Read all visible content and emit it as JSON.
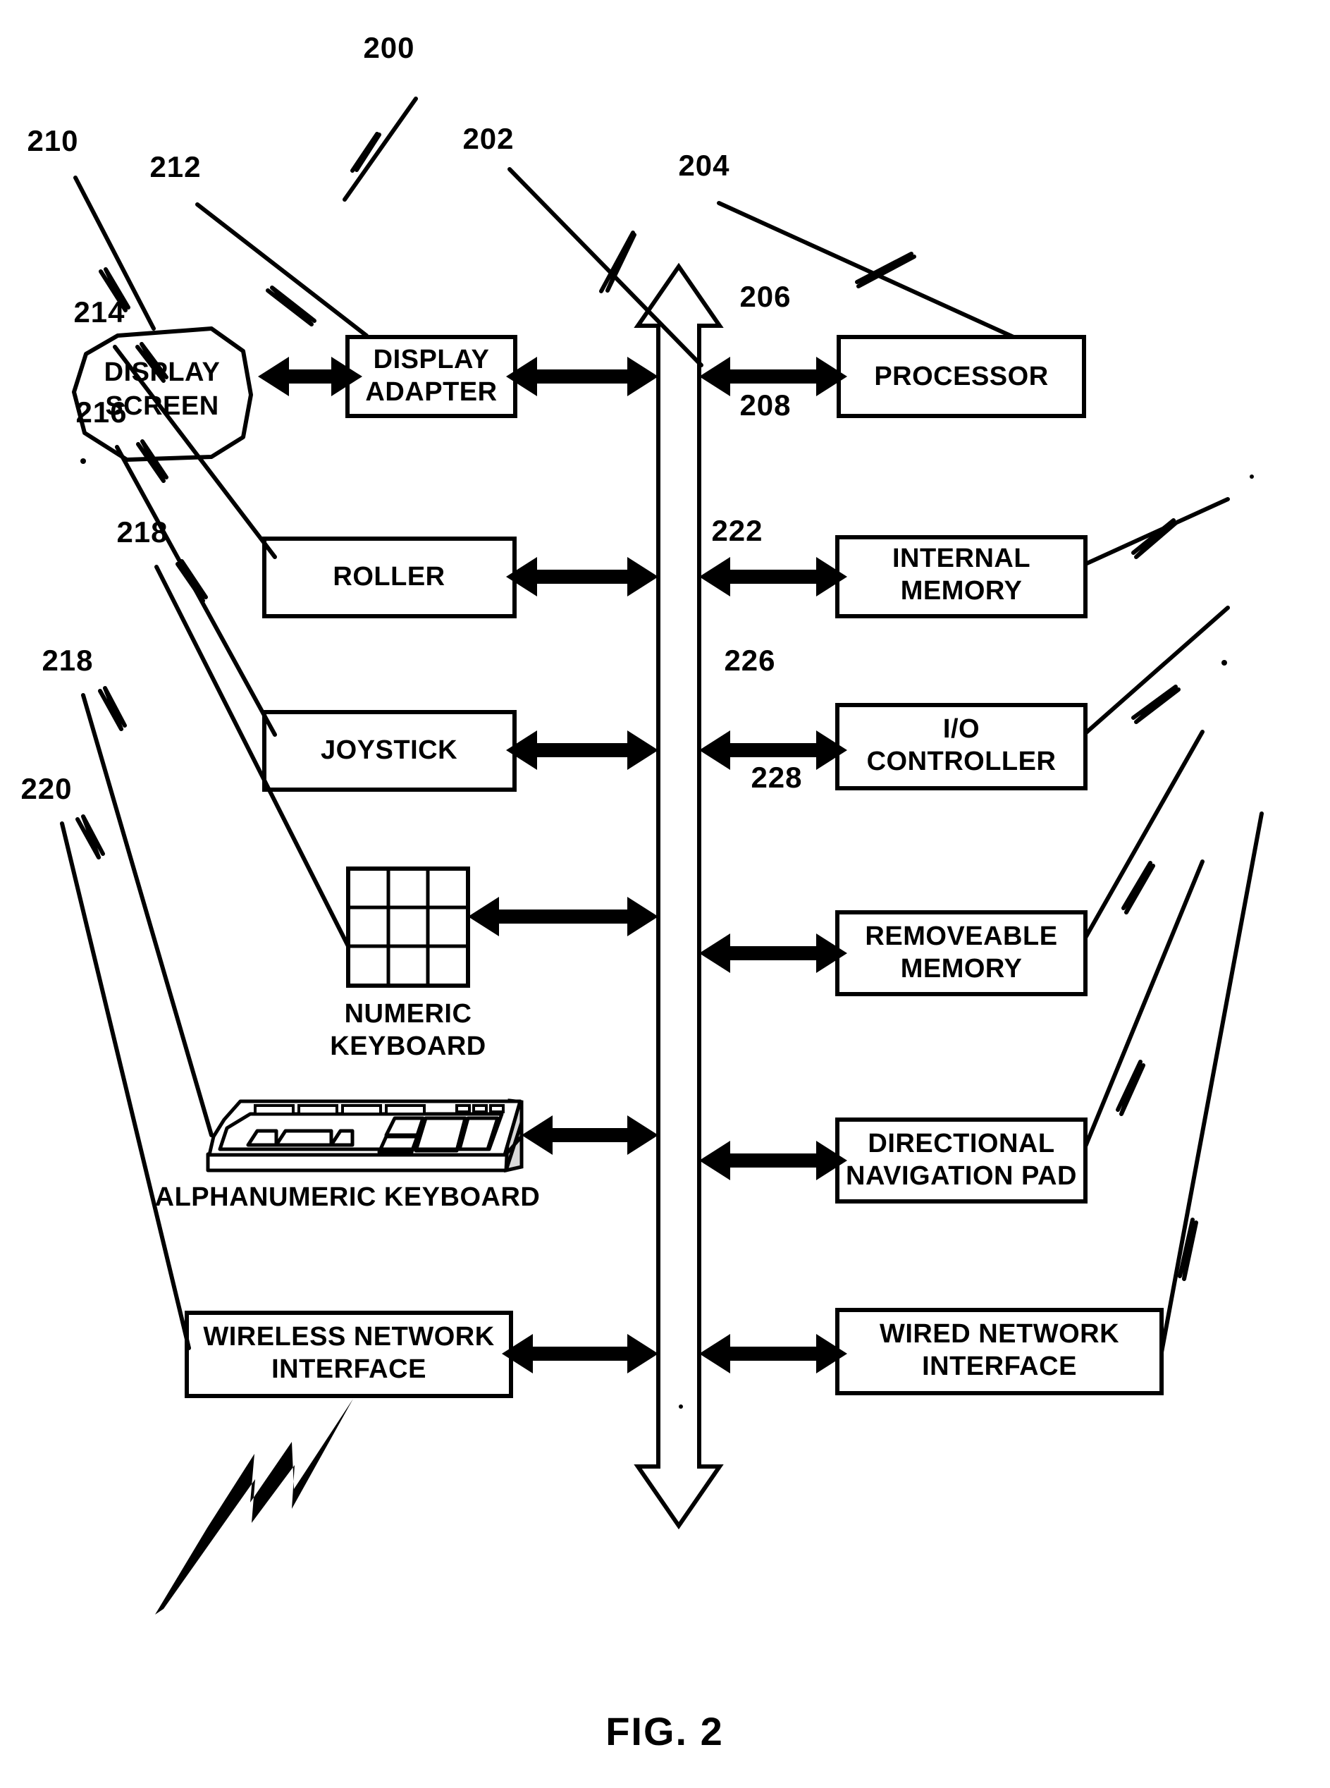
{
  "figure": {
    "caption": "FIG. 2",
    "diagram_number": "200",
    "bus_ref": "202"
  },
  "blocks": {
    "display_screen": {
      "label_line1": "DISPLAY",
      "label_line2": "SCREEN",
      "ref": "210"
    },
    "display_adapter": {
      "label_line1": "DISPLAY",
      "label_line2": "ADAPTER",
      "ref": "212"
    },
    "processor": {
      "label_line1": "PROCESSOR",
      "label_line2": "",
      "ref": "204"
    },
    "roller": {
      "label_line1": "ROLLER",
      "label_line2": "",
      "ref": "214"
    },
    "internal_memory": {
      "label_line1": "INTERNAL",
      "label_line2": "MEMORY",
      "ref": "206"
    },
    "joystick": {
      "label_line1": "JOYSTICK",
      "label_line2": "",
      "ref": "216"
    },
    "io_controller": {
      "label_line1": "I/O",
      "label_line2": "CONTROLLER",
      "ref": "208"
    },
    "numeric_keyboard": {
      "label_line1": "NUMERIC",
      "label_line2": "KEYBOARD",
      "ref": "218"
    },
    "removeable_memory": {
      "label_line1": "REMOVEABLE",
      "label_line2": "MEMORY",
      "ref": "222"
    },
    "alphanumeric_keyboard": {
      "label_line1": "ALPHANUMERIC KEYBOARD",
      "label_line2": "",
      "ref": "218"
    },
    "directional_navigation_pad": {
      "label_line1": "DIRECTIONAL",
      "label_line2": "NAVIGATION PAD",
      "ref": "226"
    },
    "wireless_network_interface": {
      "label_line1": "WIRELESS NETWORK",
      "label_line2": "INTERFACE",
      "ref": "220"
    },
    "wired_network_interface": {
      "label_line1": "WIRED NETWORK",
      "label_line2": "INTERFACE",
      "ref": "228"
    }
  },
  "colors": {
    "ink": "#000000",
    "paper": "#ffffff"
  }
}
